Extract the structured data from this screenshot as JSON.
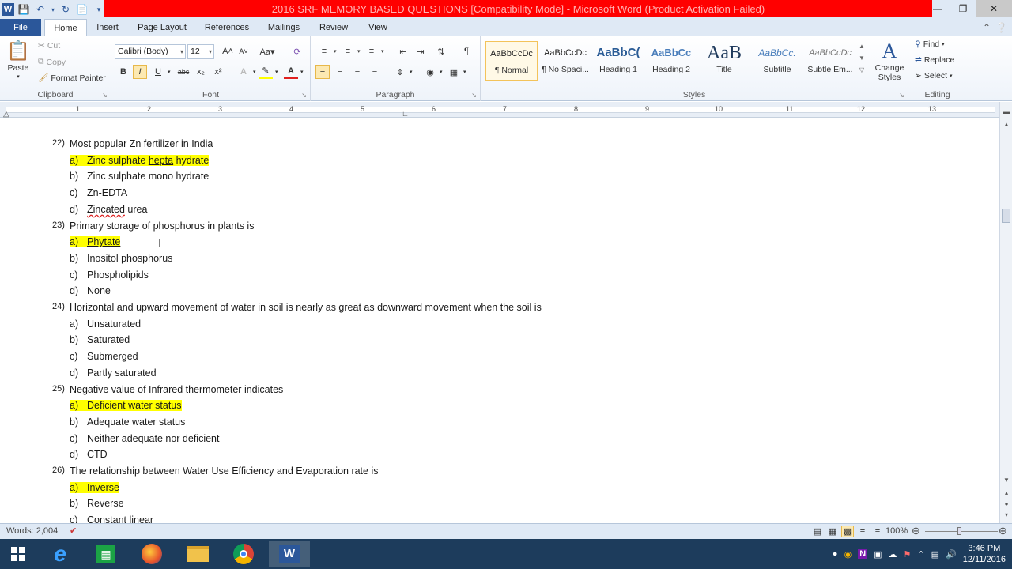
{
  "window": {
    "title": "2016 SRF MEMORY BASED QUESTIONS [Compatibility Mode]  -  Microsoft Word (Product Activation Failed)"
  },
  "tabs": [
    "File",
    "Home",
    "Insert",
    "Page Layout",
    "References",
    "Mailings",
    "Review",
    "View"
  ],
  "clipboard": {
    "paste": "Paste",
    "cut": "Cut",
    "copy": "Copy",
    "format_painter": "Format Painter",
    "label": "Clipboard"
  },
  "font": {
    "name": "Calibri (Body)",
    "size": "12",
    "label": "Font",
    "bold": "B",
    "italic": "I",
    "underline": "U",
    "strike": "abc",
    "sub": "x₂",
    "sup": "x²"
  },
  "paragraph": {
    "label": "Paragraph"
  },
  "styles": {
    "label": "Styles",
    "items": [
      {
        "sample": "AaBbCcDc",
        "name": "¶ Normal"
      },
      {
        "sample": "AaBbCcDc",
        "name": "¶ No Spaci..."
      },
      {
        "sample": "AaBbC(",
        "name": "Heading 1"
      },
      {
        "sample": "AaBbCc",
        "name": "Heading 2"
      },
      {
        "sample": "AaB",
        "name": "Title"
      },
      {
        "sample": "AaBbCc.",
        "name": "Subtitle"
      },
      {
        "sample": "AaBbCcDc",
        "name": "Subtle Em..."
      }
    ],
    "change_styles": "Change Styles",
    "accent": "#2b579a"
  },
  "editing": {
    "label": "Editing",
    "find": "Find",
    "replace": "Replace",
    "select": "Select"
  },
  "ruler": {
    "numbers": [
      "1",
      "2",
      "3",
      "4",
      "5",
      "6",
      "7",
      "8",
      "9",
      "10",
      "11",
      "12",
      "13"
    ]
  },
  "document": {
    "questions": [
      {
        "num": "22)",
        "text": "Most popular Zn fertilizer in India",
        "options": [
          {
            "letter": "a)",
            "text": "Zinc sulphate hepta hydrate",
            "highlight": true
          },
          {
            "letter": "b)",
            "text": "Zinc sulphate mono hydrate",
            "highlight": false
          },
          {
            "letter": "c)",
            "text": "Zn-EDTA",
            "highlight": false
          },
          {
            "letter": "d)",
            "text": "Zincated urea",
            "highlight": false
          }
        ]
      },
      {
        "num": "23)",
        "text": "Primary storage of phosphorus in plants is",
        "options": [
          {
            "letter": "a)",
            "text": "Phytate",
            "highlight": true
          },
          {
            "letter": "b)",
            "text": "Inositol phosphorus",
            "highlight": false
          },
          {
            "letter": "c)",
            "text": "Phospholipids",
            "highlight": false
          },
          {
            "letter": "d)",
            "text": "None",
            "highlight": false
          }
        ]
      },
      {
        "num": "24)",
        "text": "Horizontal and upward movement of water in soil is nearly as great as downward movement when the soil is",
        "options": [
          {
            "letter": "a)",
            "text": "Unsaturated",
            "highlight": false
          },
          {
            "letter": "b)",
            "text": "Saturated",
            "highlight": false
          },
          {
            "letter": "c)",
            "text": "Submerged",
            "highlight": false
          },
          {
            "letter": "d)",
            "text": "Partly saturated",
            "highlight": false
          }
        ]
      },
      {
        "num": "25)",
        "text": "Negative value of Infrared thermometer indicates",
        "options": [
          {
            "letter": "a)",
            "text": "Deficient water status",
            "highlight": true
          },
          {
            "letter": "b)",
            "text": "Adequate water status",
            "highlight": false
          },
          {
            "letter": "c)",
            "text": "Neither adequate nor deficient",
            "highlight": false
          },
          {
            "letter": "d)",
            "text": "CTD",
            "highlight": false
          }
        ]
      },
      {
        "num": "26)",
        "text": "The relationship between Water Use Efficiency and Evaporation rate is",
        "options": [
          {
            "letter": "a)",
            "text": "Inverse",
            "highlight": true
          },
          {
            "letter": "b)",
            "text": "Reverse",
            "highlight": false
          },
          {
            "letter": "c)",
            "text": "Constant linear",
            "highlight": false
          }
        ]
      }
    ]
  },
  "status": {
    "words": "Words: 2,004",
    "zoom": "100%"
  },
  "taskbar": {
    "time": "3:46 PM",
    "date": "12/11/2016"
  }
}
